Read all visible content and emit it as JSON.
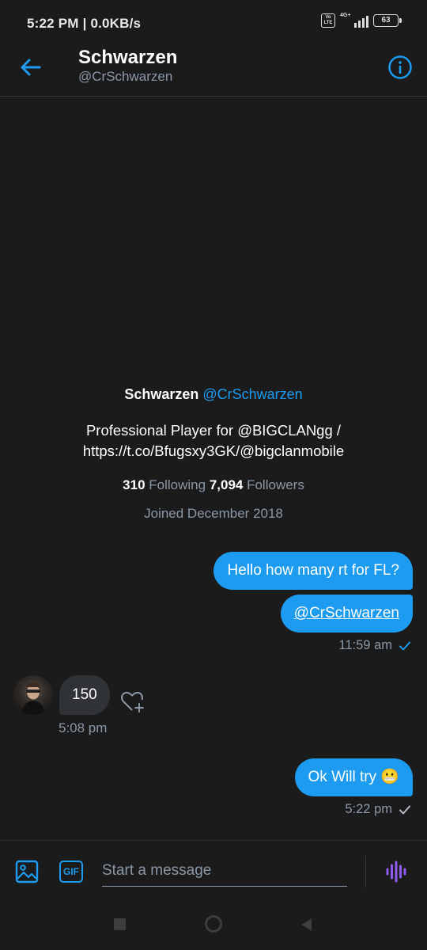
{
  "status_bar": {
    "time_speed": "5:22 PM | 0.0KB/s",
    "volte": "Vo LTE",
    "network": "4G+",
    "battery": "63"
  },
  "header": {
    "name": "Schwarzen",
    "handle": "@CrSchwarzen",
    "back_icon": "arrow-left-icon",
    "info_icon": "info-icon"
  },
  "profile": {
    "name": "Schwarzen",
    "handle": "@CrSchwarzen",
    "bio_line1": "Professional Player for @BIGCLANgg /",
    "bio_line2": "https://t.co/Bfugsxy3GK/@bigclanmobile",
    "following_count": "310",
    "following_label": "Following",
    "followers_count": "7,094",
    "followers_label": "Followers",
    "joined": "Joined December 2018"
  },
  "messages": [
    {
      "direction": "out",
      "text": "Hello how many rt for FL?"
    },
    {
      "direction": "out",
      "text": "@CrSchwarzen",
      "time": "11:59 am"
    },
    {
      "direction": "in",
      "text": "150",
      "time": "5:08 pm"
    },
    {
      "direction": "out",
      "text": "Ok Will try 😬",
      "time": "5:22 pm"
    }
  ],
  "composer": {
    "placeholder": "Start a message",
    "gif_label": "GIF"
  },
  "colors": {
    "background": "#1b1b1b",
    "accent": "#1d9bf0",
    "muted": "#8b98a5",
    "incoming_bubble": "#2f3336",
    "voice": "#8e5cf0"
  }
}
